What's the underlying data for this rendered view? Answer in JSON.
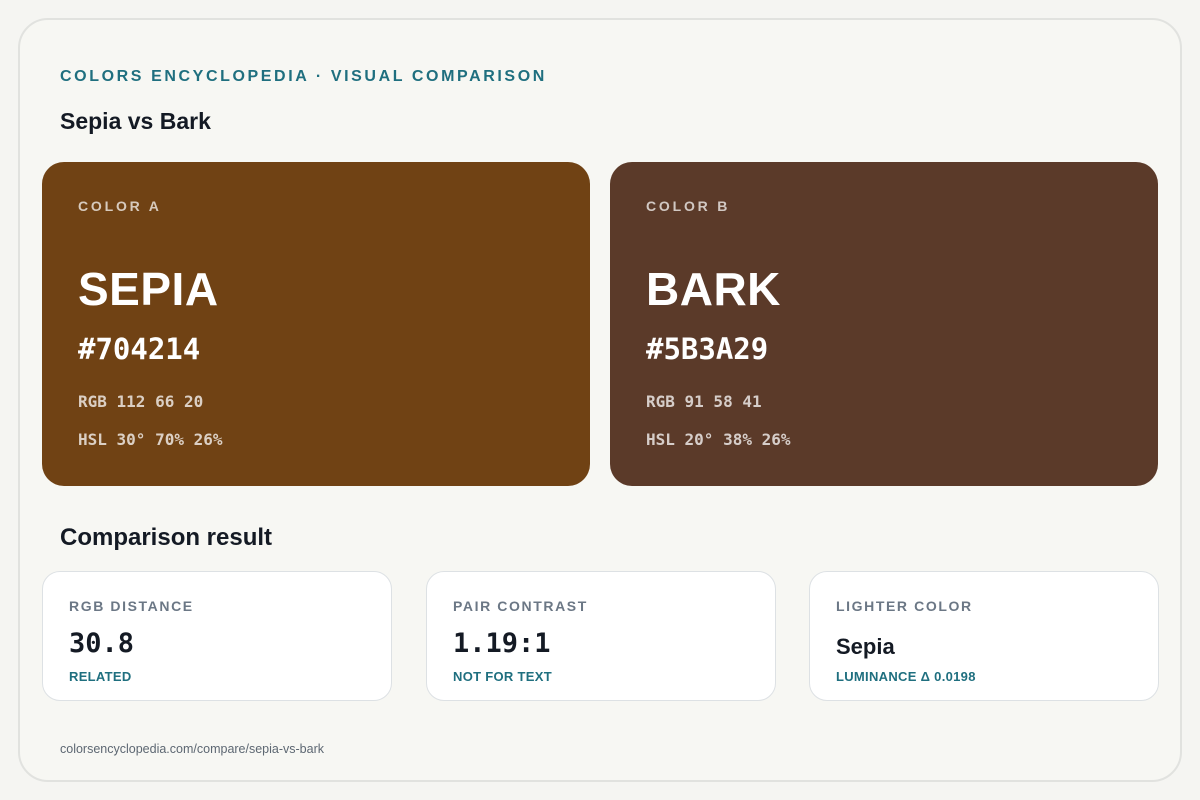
{
  "header": {
    "eyebrow": "COLORS ENCYCLOPEDIA · VISUAL COMPARISON",
    "title": "Sepia vs Bark"
  },
  "colors": {
    "a": {
      "label": "COLOR A",
      "name": "SEPIA",
      "hex": "#704214",
      "rgb": "RGB 112 66 20",
      "hsl": "HSL 30° 70% 26%",
      "swatch_color": "#704214"
    },
    "b": {
      "label": "COLOR B",
      "name": "BARK",
      "hex": "#5B3A29",
      "rgb": "RGB 91 58 41",
      "hsl": "HSL 20° 38% 26%",
      "swatch_color": "#5B3A29"
    }
  },
  "comparison": {
    "title": "Comparison result",
    "metrics": [
      {
        "label": "RGB DISTANCE",
        "value": "30.8",
        "note": "RELATED"
      },
      {
        "label": "PAIR CONTRAST",
        "value": "1.19:1",
        "note": "NOT FOR TEXT"
      },
      {
        "label": "LIGHTER COLOR",
        "value": "Sepia",
        "note": "LUMINANCE Δ 0.0198"
      }
    ]
  },
  "footer": {
    "url": "colorsencyclopedia.com/compare/sepia-vs-bark"
  },
  "theme": {
    "accent": "#1f6f7f",
    "text": "#141a24",
    "muted": "#6b7785"
  }
}
